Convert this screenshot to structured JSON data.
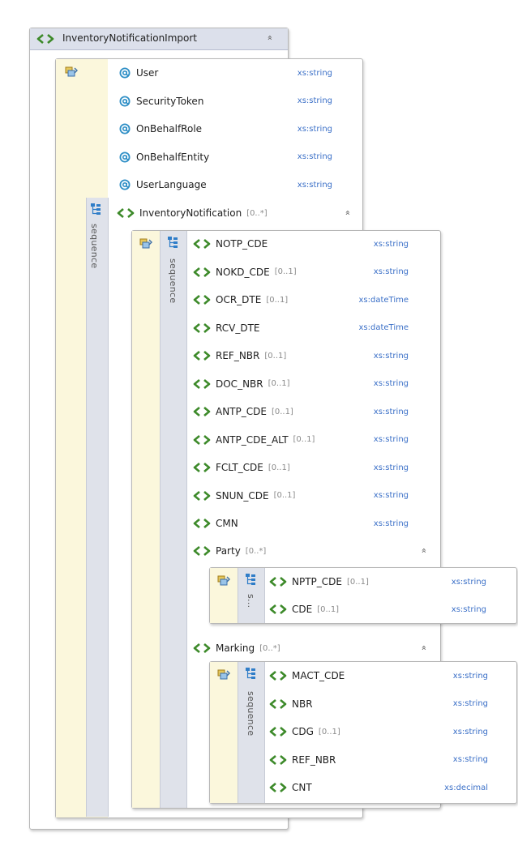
{
  "root": {
    "name": "InventoryNotificationImport",
    "collapse_symbol": "»"
  },
  "attributes": [
    {
      "name": "User",
      "type": "xs:string"
    },
    {
      "name": "SecurityToken",
      "type": "xs:string"
    },
    {
      "name": "OnBehalfRole",
      "type": "xs:string"
    },
    {
      "name": "OnBehalfEntity",
      "type": "xs:string"
    },
    {
      "name": "UserLanguage",
      "type": "xs:string"
    }
  ],
  "outer_sequence_label": "sequence",
  "inventory_notification": {
    "name": "InventoryNotification",
    "occurs": "[0..*]",
    "sequence_label": "sequence",
    "elements": [
      {
        "name": "NOTP_CDE",
        "occurs": "",
        "type": "xs:string"
      },
      {
        "name": "NOKD_CDE",
        "occurs": "[0..1]",
        "type": "xs:string"
      },
      {
        "name": "OCR_DTE",
        "occurs": "[0..1]",
        "type": "xs:dateTime"
      },
      {
        "name": "RCV_DTE",
        "occurs": "",
        "type": "xs:dateTime"
      },
      {
        "name": "REF_NBR",
        "occurs": "[0..1]",
        "type": "xs:string"
      },
      {
        "name": "DOC_NBR",
        "occurs": "[0..1]",
        "type": "xs:string"
      },
      {
        "name": "ANTP_CDE",
        "occurs": "[0..1]",
        "type": "xs:string"
      },
      {
        "name": "ANTP_CDE_ALT",
        "occurs": "[0..1]",
        "type": "xs:string"
      },
      {
        "name": "FCLT_CDE",
        "occurs": "[0..1]",
        "type": "xs:string"
      },
      {
        "name": "SNUN_CDE",
        "occurs": "[0..1]",
        "type": "xs:string"
      },
      {
        "name": "CMN",
        "occurs": "",
        "type": "xs:string"
      }
    ]
  },
  "party": {
    "name": "Party",
    "occurs": "[0..*]",
    "sequence_label": "s...",
    "elements": [
      {
        "name": "NPTP_CDE",
        "occurs": "[0..1]",
        "type": "xs:string"
      },
      {
        "name": "CDE",
        "occurs": "[0..1]",
        "type": "xs:string"
      }
    ]
  },
  "marking": {
    "name": "Marking",
    "occurs": "[0..*]",
    "sequence_label": "sequence",
    "elements": [
      {
        "name": "MACT_CDE",
        "occurs": "",
        "type": "xs:string"
      },
      {
        "name": "NBR",
        "occurs": "",
        "type": "xs:string"
      },
      {
        "name": "CDG",
        "occurs": "[0..1]",
        "type": "xs:string"
      },
      {
        "name": "REF_NBR",
        "occurs": "",
        "type": "xs:string"
      },
      {
        "name": "CNT",
        "occurs": "",
        "type": "xs:decimal"
      }
    ]
  },
  "colors": {
    "element_icon": "#3d8a2a",
    "attribute_icon": "#2f8fc6",
    "type_text": "#3a6fc7",
    "complex_bg": "#fbf7dc",
    "sequence_bar": "#dfe2ea"
  }
}
